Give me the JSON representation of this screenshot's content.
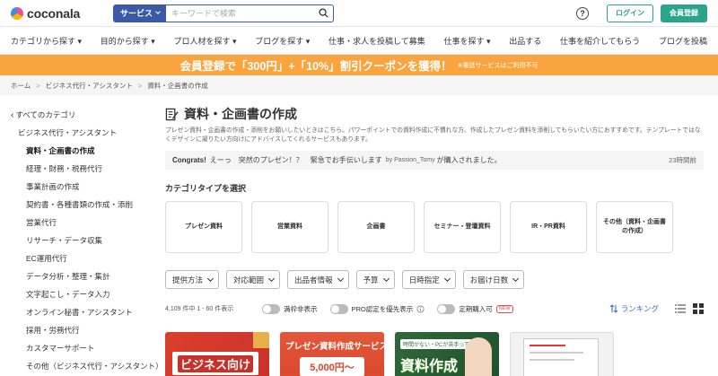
{
  "brand": {
    "name": "coconala"
  },
  "search": {
    "category_label": "サービス",
    "placeholder": "キーワードで検索"
  },
  "header": {
    "help_label": "?",
    "login_label": "ログイン",
    "register_label": "会員登録"
  },
  "nav": [
    "カテゴリから探す ▾",
    "目的から探す ▾",
    "プロ人材を探す ▾",
    "ブログを探す ▾",
    "仕事・求人を投稿して募集",
    "仕事を探す ▾",
    "出品する",
    "仕事を紹介してもらう",
    "ブログを投稿"
  ],
  "banner": {
    "text": "会員登録で「300円」+「10%」割引クーポンを獲得！",
    "note": "※電話サービスはご利用不可"
  },
  "breadcrumb": [
    "ホーム",
    "ビジネス代行・アシスタント",
    "資料・企画書の作成"
  ],
  "sidebar": {
    "back": "すべてのカテゴリ",
    "parent": "ビジネス代行・アシスタント",
    "items": [
      "資料・企画書の作成",
      "経理・財務・税務代行",
      "事業計画の作成",
      "契約書・各種書類の作成・添削",
      "営業代行",
      "リサーチ・データ収集",
      "EC運用代行",
      "データ分析・整理・集計",
      "文字起こし・データ入力",
      "オンライン秘書・アシスタント",
      "採用・労務代行",
      "カスタマーサポート",
      "その他（ビジネス代行・アシスタント）"
    ]
  },
  "main": {
    "title": "資料・企画書の作成",
    "description": "プレゼン資料・企画書の作成・添削をお願いしたいときはこちら。パワーポイントでの資料作成に不慣れな方、作成したプレゼン資料を添削してもらいたい方におすすめです。テンプレートではなくデザインに凝りたい方向けにアドバイスしてくれるサービスもあります。",
    "notice": {
      "lead": "Congrats!",
      "text": "えーっ　突然のプレゼン！？　緊急でお手伝いします",
      "by": "by Passion_Tomy",
      "action": "が購入されました。",
      "time": "23時間前"
    },
    "category_section_label": "カテゴリタイプを選択",
    "category_types": [
      "プレゼン資料",
      "営業資料",
      "企画書",
      "セミナー・登壇資料",
      "IR・PR資料",
      "その他（資料・企画書の作成）"
    ],
    "filters": [
      "提供方法",
      "対応範囲",
      "出品者情報",
      "予算",
      "日時指定",
      "お届け日数"
    ],
    "results_count": "4,109 件中 1 - 60 件表示",
    "toggles": [
      {
        "label": "満枠非表示"
      },
      {
        "label": "PRO認定を優先表示",
        "has_info": true
      },
      {
        "label": "定期購入可",
        "badge": "NEW"
      }
    ],
    "sort_label": "ランキング",
    "thumbnails": [
      {
        "text": "ビジネス向け"
      },
      {
        "line1": "プレゼン資料作成サービス",
        "line2": "5,000円〜"
      },
      {
        "tag": "時間がない・PCが苦手って方へ",
        "text": "資料作成"
      },
      {}
    ]
  },
  "colors": {
    "brand_green": "#2aa58a",
    "banner_orange": "#f9a43f",
    "search_blue": "#3a5aa8",
    "sort_blue": "#3a6fc8"
  }
}
